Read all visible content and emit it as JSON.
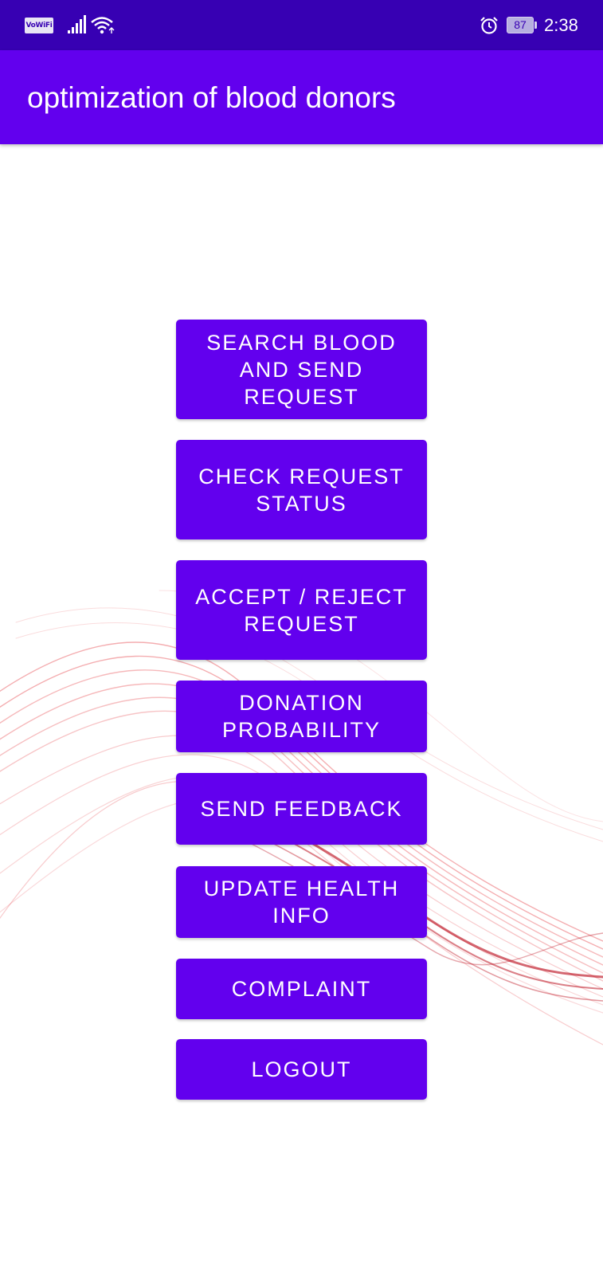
{
  "status_bar": {
    "network_badge": "VoWiFi",
    "battery_level": "87",
    "time": "2:38",
    "icons": [
      "signal-icon",
      "wifi-icon",
      "alarm-icon",
      "battery-icon"
    ]
  },
  "app_bar": {
    "title": "optimization of blood donors"
  },
  "menu": {
    "buttons": [
      {
        "label": "SEARCH BLOOD AND SEND REQUEST"
      },
      {
        "label": "CHECK REQUEST STATUS"
      },
      {
        "label": "ACCEPT / REJECT REQUEST"
      },
      {
        "label": "DONATION PROBABILITY"
      },
      {
        "label": "SEND FEEDBACK"
      },
      {
        "label": "UPDATE HEALTH INFO"
      },
      {
        "label": "COMPLAINT"
      },
      {
        "label": "LOGOUT"
      }
    ]
  },
  "colors": {
    "status_bar": "#3700b3",
    "primary": "#6200ee",
    "background": "#ffffff",
    "ribbon": "#e0141c"
  }
}
